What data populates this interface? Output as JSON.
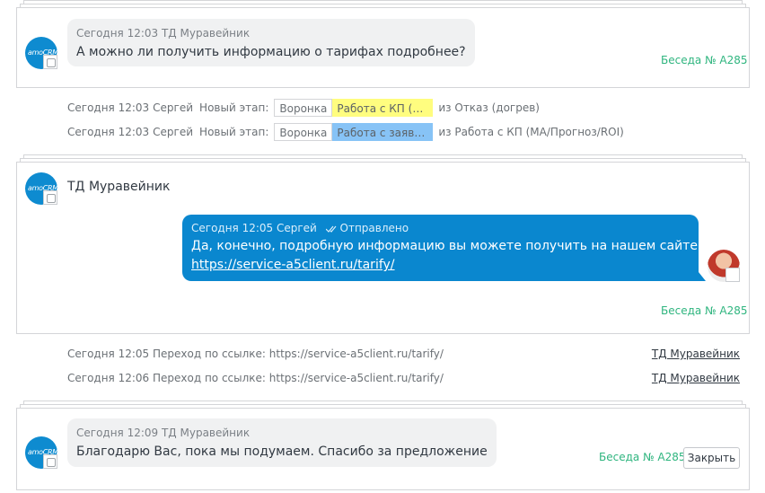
{
  "block1": {
    "meta": "Сегодня 12:03 ТД Муравейник",
    "text": "А можно ли получить информацию о тарифах подробнее?",
    "talk_link": "Беседа № A285",
    "logo_text": "amoCRM"
  },
  "events": [
    {
      "time": "Сегодня 12:03",
      "who": "Сергей",
      "what": "Новый этап:",
      "pipeline": "Воронка",
      "stage": "Работа с КП (МА/Прогноз/ROI)",
      "stage_shown": "Работа с КП (М...",
      "stage_color": "#fffd7f",
      "from": "из Отказ (догрев)"
    },
    {
      "time": "Сегодня 12:03",
      "who": "Сергей",
      "what": "Новый этап:",
      "pipeline": "Воронка",
      "stage": "Работа с заявкой",
      "stage_shown": "Работа с заявко...",
      "stage_color": "#87c3f6",
      "from": "из Работа с КП (МА/Прогноз/ROI)"
    }
  ],
  "block2": {
    "contact": "ТД Муравейник",
    "logo_text": "amoCRM",
    "outgoing": {
      "meta": "Сегодня 12:05 Сергей",
      "status": "Отправлено",
      "text": "Да, конечно, подробную информацию вы можете получить на нашем сайте",
      "link": "https://service-a5client.ru/tarify/"
    },
    "talk_link": "Беседа № A285"
  },
  "link_events": [
    {
      "text": "Сегодня 12:05 Переход по ссылке: https://service-a5client.ru/tarify/",
      "contact": "ТД Муравейник"
    },
    {
      "text": "Сегодня 12:06 Переход по ссылке: https://service-a5client.ru/tarify/",
      "contact": "ТД Муравейник"
    }
  ],
  "block3": {
    "meta": "Сегодня 12:09 ТД Муравейник",
    "text": "Благодарю Вас, пока мы подумаем. Спасибо за предложение",
    "talk_link": "Беседа № A285",
    "close_label": "Закрыть",
    "logo_text": "amoCRM"
  },
  "colors": {
    "accent_green": "#2fb57f",
    "outgoing_bubble": "#0a87cf",
    "incoming_bubble": "#f0f1f2",
    "amocrm_blue": "#0e8bd0"
  }
}
